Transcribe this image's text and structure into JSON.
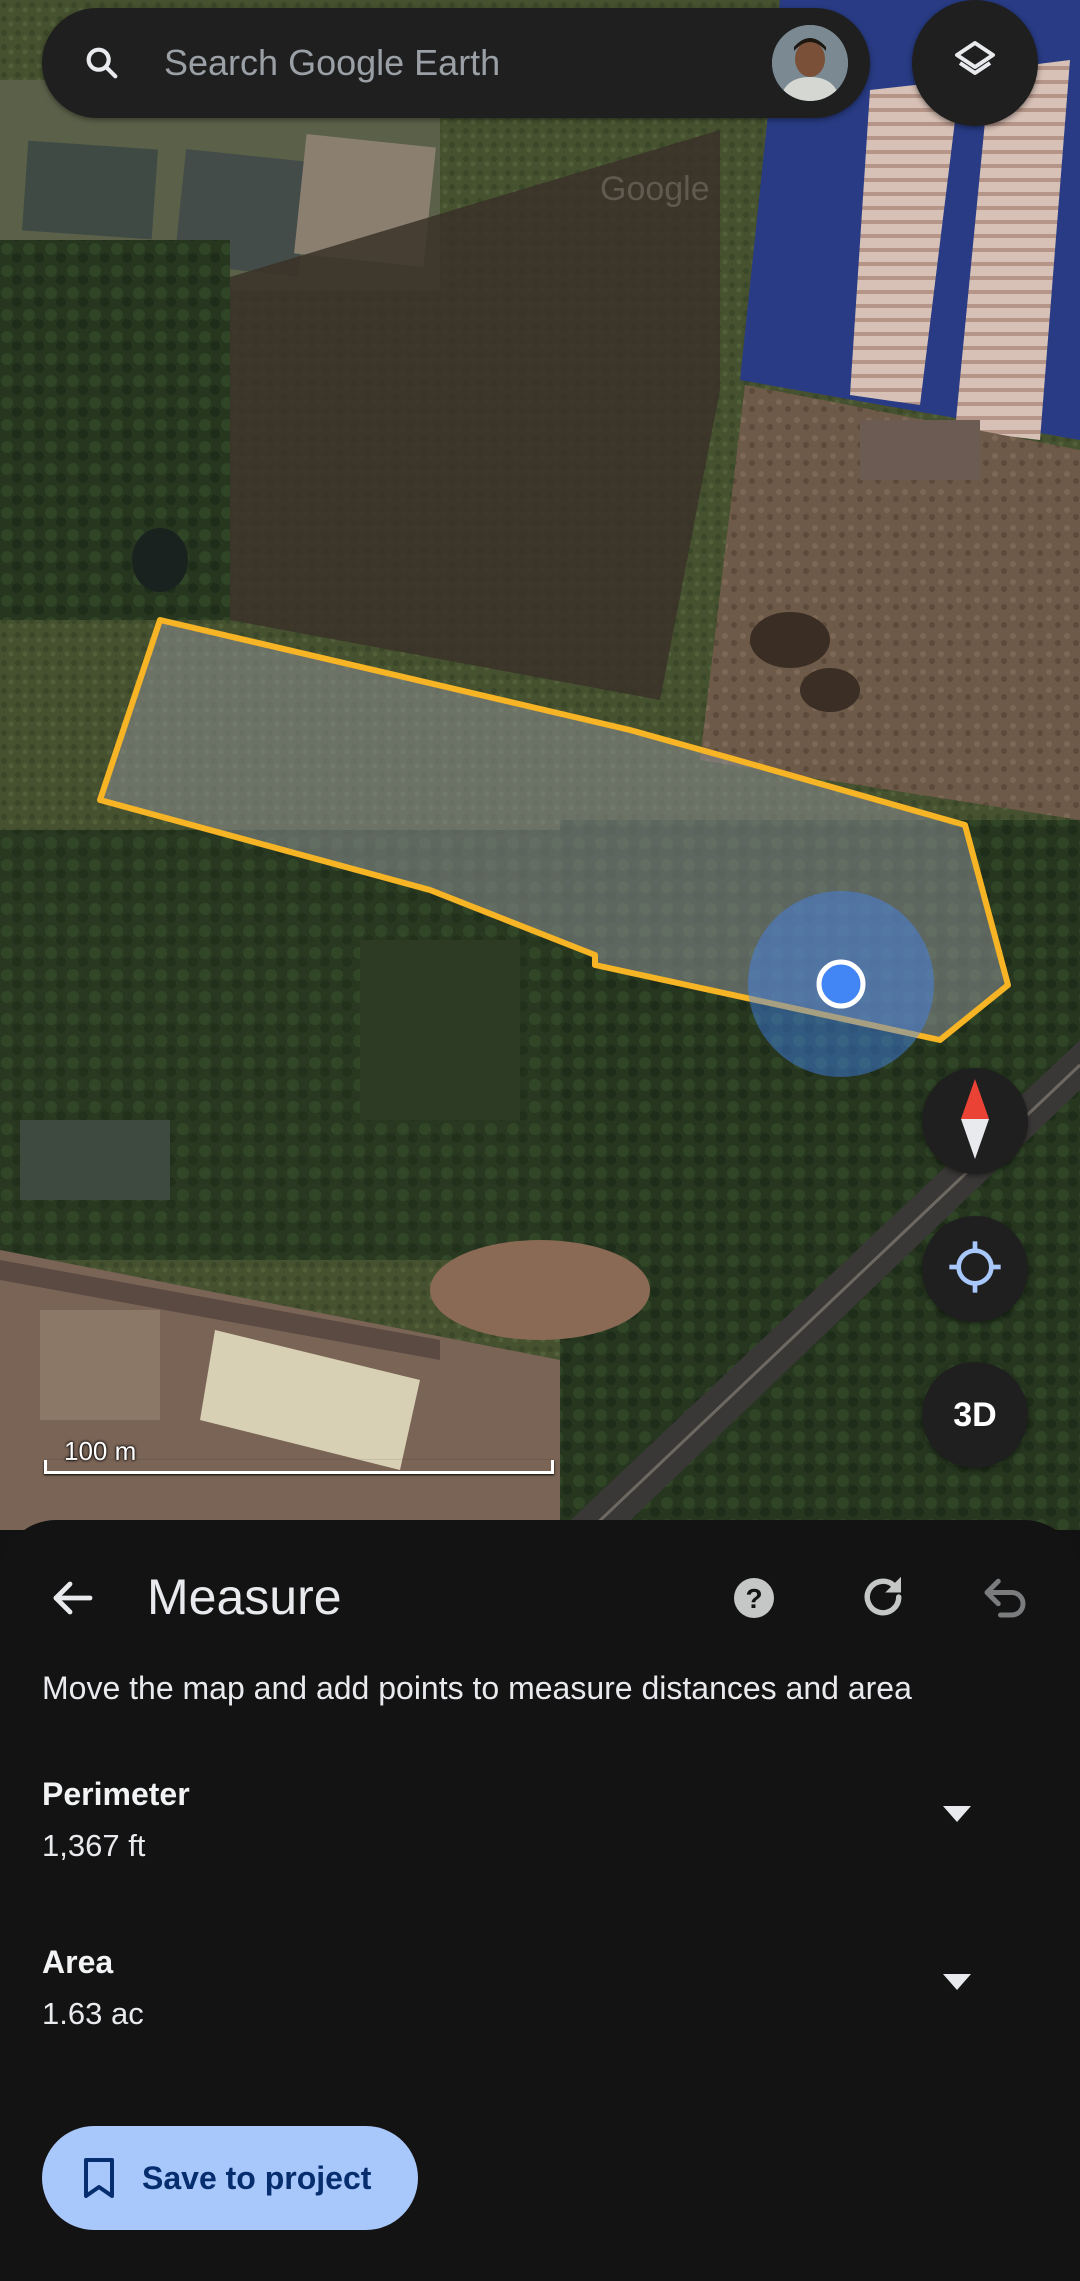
{
  "search": {
    "placeholder": "Search Google Earth"
  },
  "map": {
    "scale_label": "100 m",
    "watermark": "Google",
    "three_d_label": "3D",
    "polygon_color": "#f7b424",
    "location_color": "#4285f4"
  },
  "measure": {
    "title": "Measure",
    "instruction": "Move the map and add points to measure distances and area",
    "perimeter": {
      "label": "Perimeter",
      "value": "1,367 ft"
    },
    "area": {
      "label": "Area",
      "value": "1.63 ac"
    },
    "save_label": "Save to project"
  },
  "icons": {
    "search": "search-icon",
    "layers": "layers-icon",
    "compass": "compass-icon",
    "locate": "my-location-icon",
    "back": "arrow-back-icon",
    "help": "help-icon",
    "refresh": "refresh-icon",
    "undo": "undo-icon",
    "dropdown": "arrow-drop-down-icon",
    "bookmark": "bookmark-icon"
  },
  "colors": {
    "accent": "#a8c7fa",
    "sheet_bg": "#131313",
    "button_bg": "#1f1f1f"
  }
}
